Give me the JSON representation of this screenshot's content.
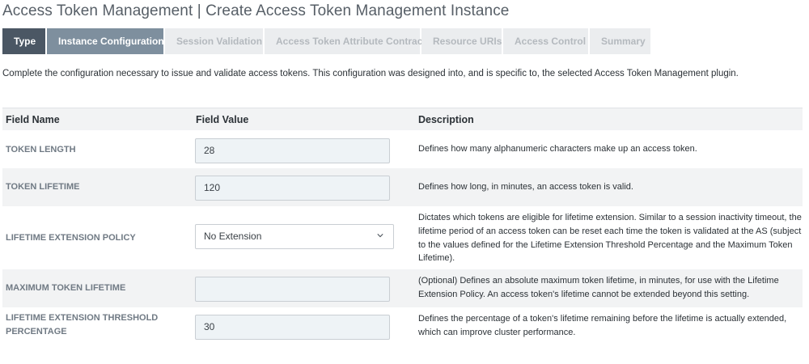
{
  "page": {
    "title": "Access Token Management | Create Access Token Management Instance",
    "intro": "Complete the configuration necessary to issue and validate access tokens. This configuration was designed into, and is specific to, the selected Access Token Management plugin."
  },
  "tabs": [
    {
      "label": "Type",
      "state": "completed"
    },
    {
      "label": "Instance Configuration",
      "state": "active"
    },
    {
      "label": "Session Validation",
      "state": "inactive"
    },
    {
      "label": "Access Token Attribute Contract",
      "state": "inactive"
    },
    {
      "label": "Resource URIs",
      "state": "inactive"
    },
    {
      "label": "Access Control",
      "state": "inactive"
    },
    {
      "label": "Summary",
      "state": "inactive"
    }
  ],
  "table": {
    "headers": {
      "field_name": "Field Name",
      "field_value": "Field Value",
      "description": "Description"
    },
    "rows": [
      {
        "field_name": "TOKEN LENGTH",
        "value": "28",
        "type": "text",
        "description": "Defines how many alphanumeric characters make up an access token."
      },
      {
        "field_name": "TOKEN LIFETIME",
        "value": "120",
        "type": "text",
        "description": "Defines how long, in minutes, an access token is valid."
      },
      {
        "field_name": "LIFETIME EXTENSION POLICY",
        "value": "No Extension",
        "type": "select",
        "description": "Dictates which tokens are eligible for lifetime extension. Similar to a session inactivity timeout, the lifetime period of an access token can be reset each time the token is validated at the AS (subject to the values defined for the Lifetime Extension Threshold Percentage and the Maximum Token Lifetime)."
      },
      {
        "field_name": "MAXIMUM TOKEN LIFETIME",
        "value": "",
        "type": "text",
        "description": "(Optional) Defines an absolute maximum token lifetime, in minutes, for use with the Lifetime Extension Policy. An access token's lifetime cannot be extended beyond this setting."
      },
      {
        "field_name": "LIFETIME EXTENSION THRESHOLD PERCENTAGE",
        "value": "30",
        "type": "text",
        "description": "Defines the percentage of a token's lifetime remaining before the lifetime is actually extended, which can improve cluster performance."
      }
    ]
  },
  "icons": {
    "select_arrow": "chevron-down-icon"
  },
  "colors": {
    "tab_completed": "#4b5764",
    "tab_active": "#7e8f9e",
    "tab_inactive": "#ebedef",
    "input_bg": "#eef3f6",
    "row_alt_bg": "#f2f3f4"
  }
}
